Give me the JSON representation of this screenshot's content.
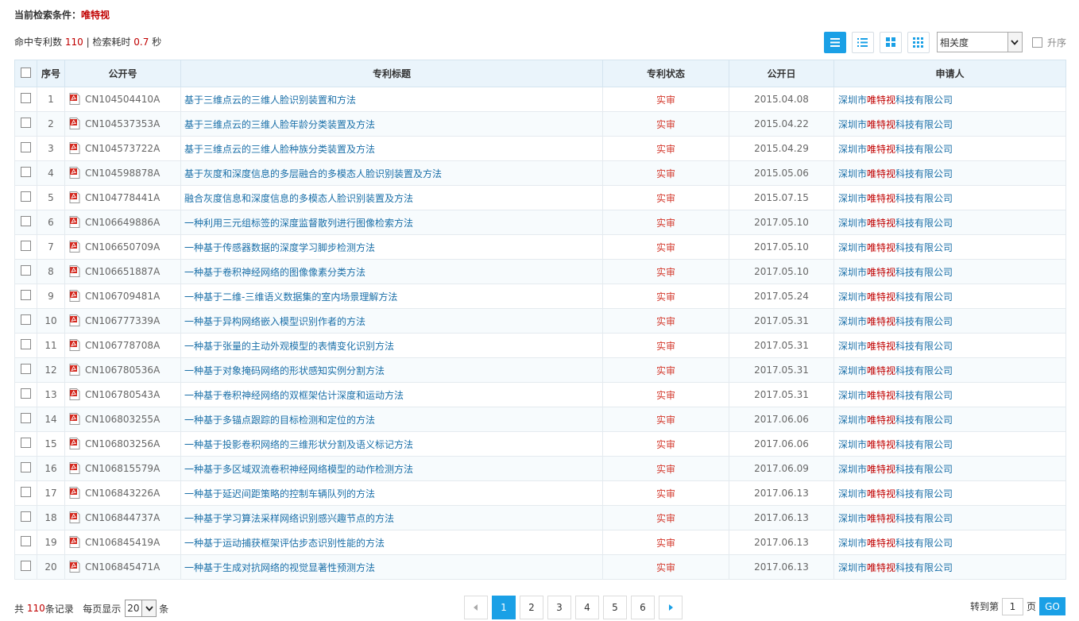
{
  "search_condition": {
    "label": "当前检索条件：",
    "keyword": "唯特视"
  },
  "stats": {
    "hits_label": "命中专利数",
    "hits": "110",
    "sep": "| 检索耗时",
    "time": "0.7",
    "unit": "秒"
  },
  "toolbar": {
    "view_icons": [
      "list-detail-icon",
      "list-compact-icon",
      "grid-4-icon",
      "grid-9-icon"
    ],
    "active_view": 0,
    "sort_selected": "相关度",
    "asc_label": "升序"
  },
  "table": {
    "headers": {
      "no": "序号",
      "pub": "公开号",
      "title": "专利标题",
      "status": "专利状态",
      "date": "公开日",
      "applicant": "申请人"
    },
    "applicant": {
      "pre": "深圳市",
      "kw": "唯特视",
      "post": "科技有限公司"
    },
    "rows": [
      {
        "no": "1",
        "pub": "CN104504410A",
        "title": "基于三维点云的三维人脸识别装置和方法",
        "status": "实审",
        "date": "2015.04.08"
      },
      {
        "no": "2",
        "pub": "CN104537353A",
        "title": "基于三维点云的三维人脸年龄分类装置及方法",
        "status": "实审",
        "date": "2015.04.22"
      },
      {
        "no": "3",
        "pub": "CN104573722A",
        "title": "基于三维点云的三维人脸种族分类装置及方法",
        "status": "实审",
        "date": "2015.04.29"
      },
      {
        "no": "4",
        "pub": "CN104598878A",
        "title": "基于灰度和深度信息的多层融合的多模态人脸识别装置及方法",
        "status": "实审",
        "date": "2015.05.06"
      },
      {
        "no": "5",
        "pub": "CN104778441A",
        "title": "融合灰度信息和深度信息的多模态人脸识别装置及方法",
        "status": "实审",
        "date": "2015.07.15"
      },
      {
        "no": "6",
        "pub": "CN106649886A",
        "title": "一种利用三元组标签的深度监督散列进行图像检索方法",
        "status": "实审",
        "date": "2017.05.10"
      },
      {
        "no": "7",
        "pub": "CN106650709A",
        "title": "一种基于传感器数据的深度学习脚步检测方法",
        "status": "实审",
        "date": "2017.05.10"
      },
      {
        "no": "8",
        "pub": "CN106651887A",
        "title": "一种基于卷积神经网络的图像像素分类方法",
        "status": "实审",
        "date": "2017.05.10"
      },
      {
        "no": "9",
        "pub": "CN106709481A",
        "title": "一种基于二维-三维语义数据集的室内场景理解方法",
        "status": "实审",
        "date": "2017.05.24"
      },
      {
        "no": "10",
        "pub": "CN106777339A",
        "title": "一种基于异构网络嵌入模型识别作者的方法",
        "status": "实审",
        "date": "2017.05.31"
      },
      {
        "no": "11",
        "pub": "CN106778708A",
        "title": "一种基于张量的主动外观模型的表情变化识别方法",
        "status": "实审",
        "date": "2017.05.31"
      },
      {
        "no": "12",
        "pub": "CN106780536A",
        "title": "一种基于对象掩码网络的形状感知实例分割方法",
        "status": "实审",
        "date": "2017.05.31"
      },
      {
        "no": "13",
        "pub": "CN106780543A",
        "title": "一种基于卷积神经网络的双框架估计深度和运动方法",
        "status": "实审",
        "date": "2017.05.31"
      },
      {
        "no": "14",
        "pub": "CN106803255A",
        "title": "一种基于多锚点跟踪的目标检测和定位的方法",
        "status": "实审",
        "date": "2017.06.06"
      },
      {
        "no": "15",
        "pub": "CN106803256A",
        "title": "一种基于投影卷积网络的三维形状分割及语义标记方法",
        "status": "实审",
        "date": "2017.06.06"
      },
      {
        "no": "16",
        "pub": "CN106815579A",
        "title": "一种基于多区域双流卷积神经网络模型的动作检测方法",
        "status": "实审",
        "date": "2017.06.09"
      },
      {
        "no": "17",
        "pub": "CN106843226A",
        "title": "一种基于延迟间距策略的控制车辆队列的方法",
        "status": "实审",
        "date": "2017.06.13"
      },
      {
        "no": "18",
        "pub": "CN106844737A",
        "title": "一种基于学习算法采样网络识别感兴趣节点的方法",
        "status": "实审",
        "date": "2017.06.13"
      },
      {
        "no": "19",
        "pub": "CN106845419A",
        "title": "一种基于运动捕获框架评估步态识别性能的方法",
        "status": "实审",
        "date": "2017.06.13"
      },
      {
        "no": "20",
        "pub": "CN106845471A",
        "title": "一种基于生成对抗网络的视觉显著性预测方法",
        "status": "实审",
        "date": "2017.06.13"
      }
    ]
  },
  "footer": {
    "total_pre": "共",
    "total": "110",
    "total_post": "条记录",
    "per_page_label": "每页显示",
    "per_page": "20",
    "per_page_unit": "条",
    "pages": [
      "1",
      "2",
      "3",
      "4",
      "5",
      "6"
    ],
    "current_page": "1",
    "goto_label": "转到第",
    "goto_value": "1",
    "goto_unit": "页",
    "go_label": "GO"
  },
  "colors": {
    "accent": "#1aa0e6",
    "highlight": "#c00000",
    "link": "#1a6fa8",
    "status": "#d43b2f",
    "header_bg": "#eaf4fb"
  }
}
